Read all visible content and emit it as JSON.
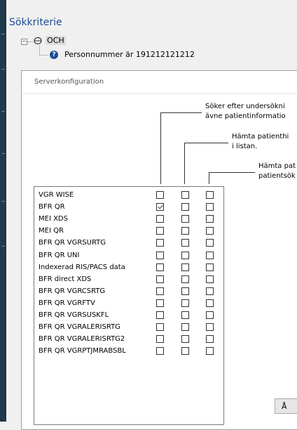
{
  "search_criteria": {
    "title": "Sökkriterie",
    "operator": "OCH",
    "criterion": "Personnummer är 191212121212"
  },
  "dialog": {
    "title": "Serverkonfiguration",
    "column_descriptions": [
      "Söker efter undersökni\nävne patientinformatio",
      "Hämta patienthi\ni listan.",
      "Hämta pat\npatientsök"
    ],
    "servers": [
      {
        "name": "VGR WISE",
        "checks": [
          false,
          false,
          false
        ]
      },
      {
        "name": "BFR QR",
        "checks": [
          true,
          false,
          false
        ]
      },
      {
        "name": "MEI XDS",
        "checks": [
          false,
          false,
          false
        ]
      },
      {
        "name": "MEI QR",
        "checks": [
          false,
          false,
          false
        ]
      },
      {
        "name": "BFR QR VGRSURTG",
        "checks": [
          false,
          false,
          false
        ]
      },
      {
        "name": "BFR QR UNI",
        "checks": [
          false,
          false,
          false
        ]
      },
      {
        "name": "Indexerad RIS/PACS data",
        "checks": [
          false,
          false,
          false
        ]
      },
      {
        "name": "BFR direct XDS",
        "checks": [
          false,
          false,
          false
        ]
      },
      {
        "name": "BFR QR VGRCSRTG",
        "checks": [
          false,
          false,
          false
        ]
      },
      {
        "name": "BFR QR VGRFTV",
        "checks": [
          false,
          false,
          false
        ]
      },
      {
        "name": "BFR QR VGRSUSKFL",
        "checks": [
          false,
          false,
          false
        ]
      },
      {
        "name": "BFR QR VGRALERISRTG",
        "checks": [
          false,
          false,
          false
        ]
      },
      {
        "name": "BFR QR VGRALERISRTG2",
        "checks": [
          false,
          false,
          false
        ]
      },
      {
        "name": "BFR QR VGRPTJMRABSBL",
        "checks": [
          false,
          false,
          false
        ]
      }
    ],
    "partial_button_label": "Å"
  }
}
